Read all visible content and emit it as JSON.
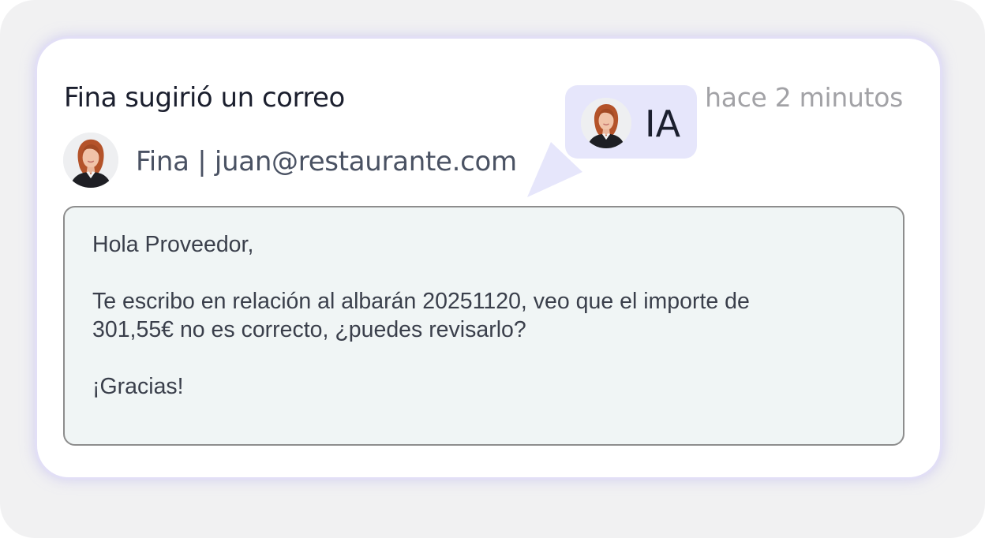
{
  "card": {
    "title": "Fina sugirió un correo",
    "timestamp": "hace 2 minutos",
    "sender": "Fina | juan@restaurante.com"
  },
  "badge": {
    "label": "IA"
  },
  "email": {
    "greeting": "Hola Proveedor,",
    "line1": "Te escribo en relación al albarán 20251120, veo que el importe de",
    "line2": "301,55€ no es correcto, ¿puedes revisarlo?",
    "closing": "¡Gracias!"
  },
  "icons": {
    "avatar": "avatar-woman-icon",
    "pointer": "speech-pointer-icon"
  },
  "colors": {
    "badge_bg": "#e6e6fb",
    "body_bg": "#f0f5f5",
    "title": "#1b1f2e",
    "muted": "#a2a2a6"
  }
}
